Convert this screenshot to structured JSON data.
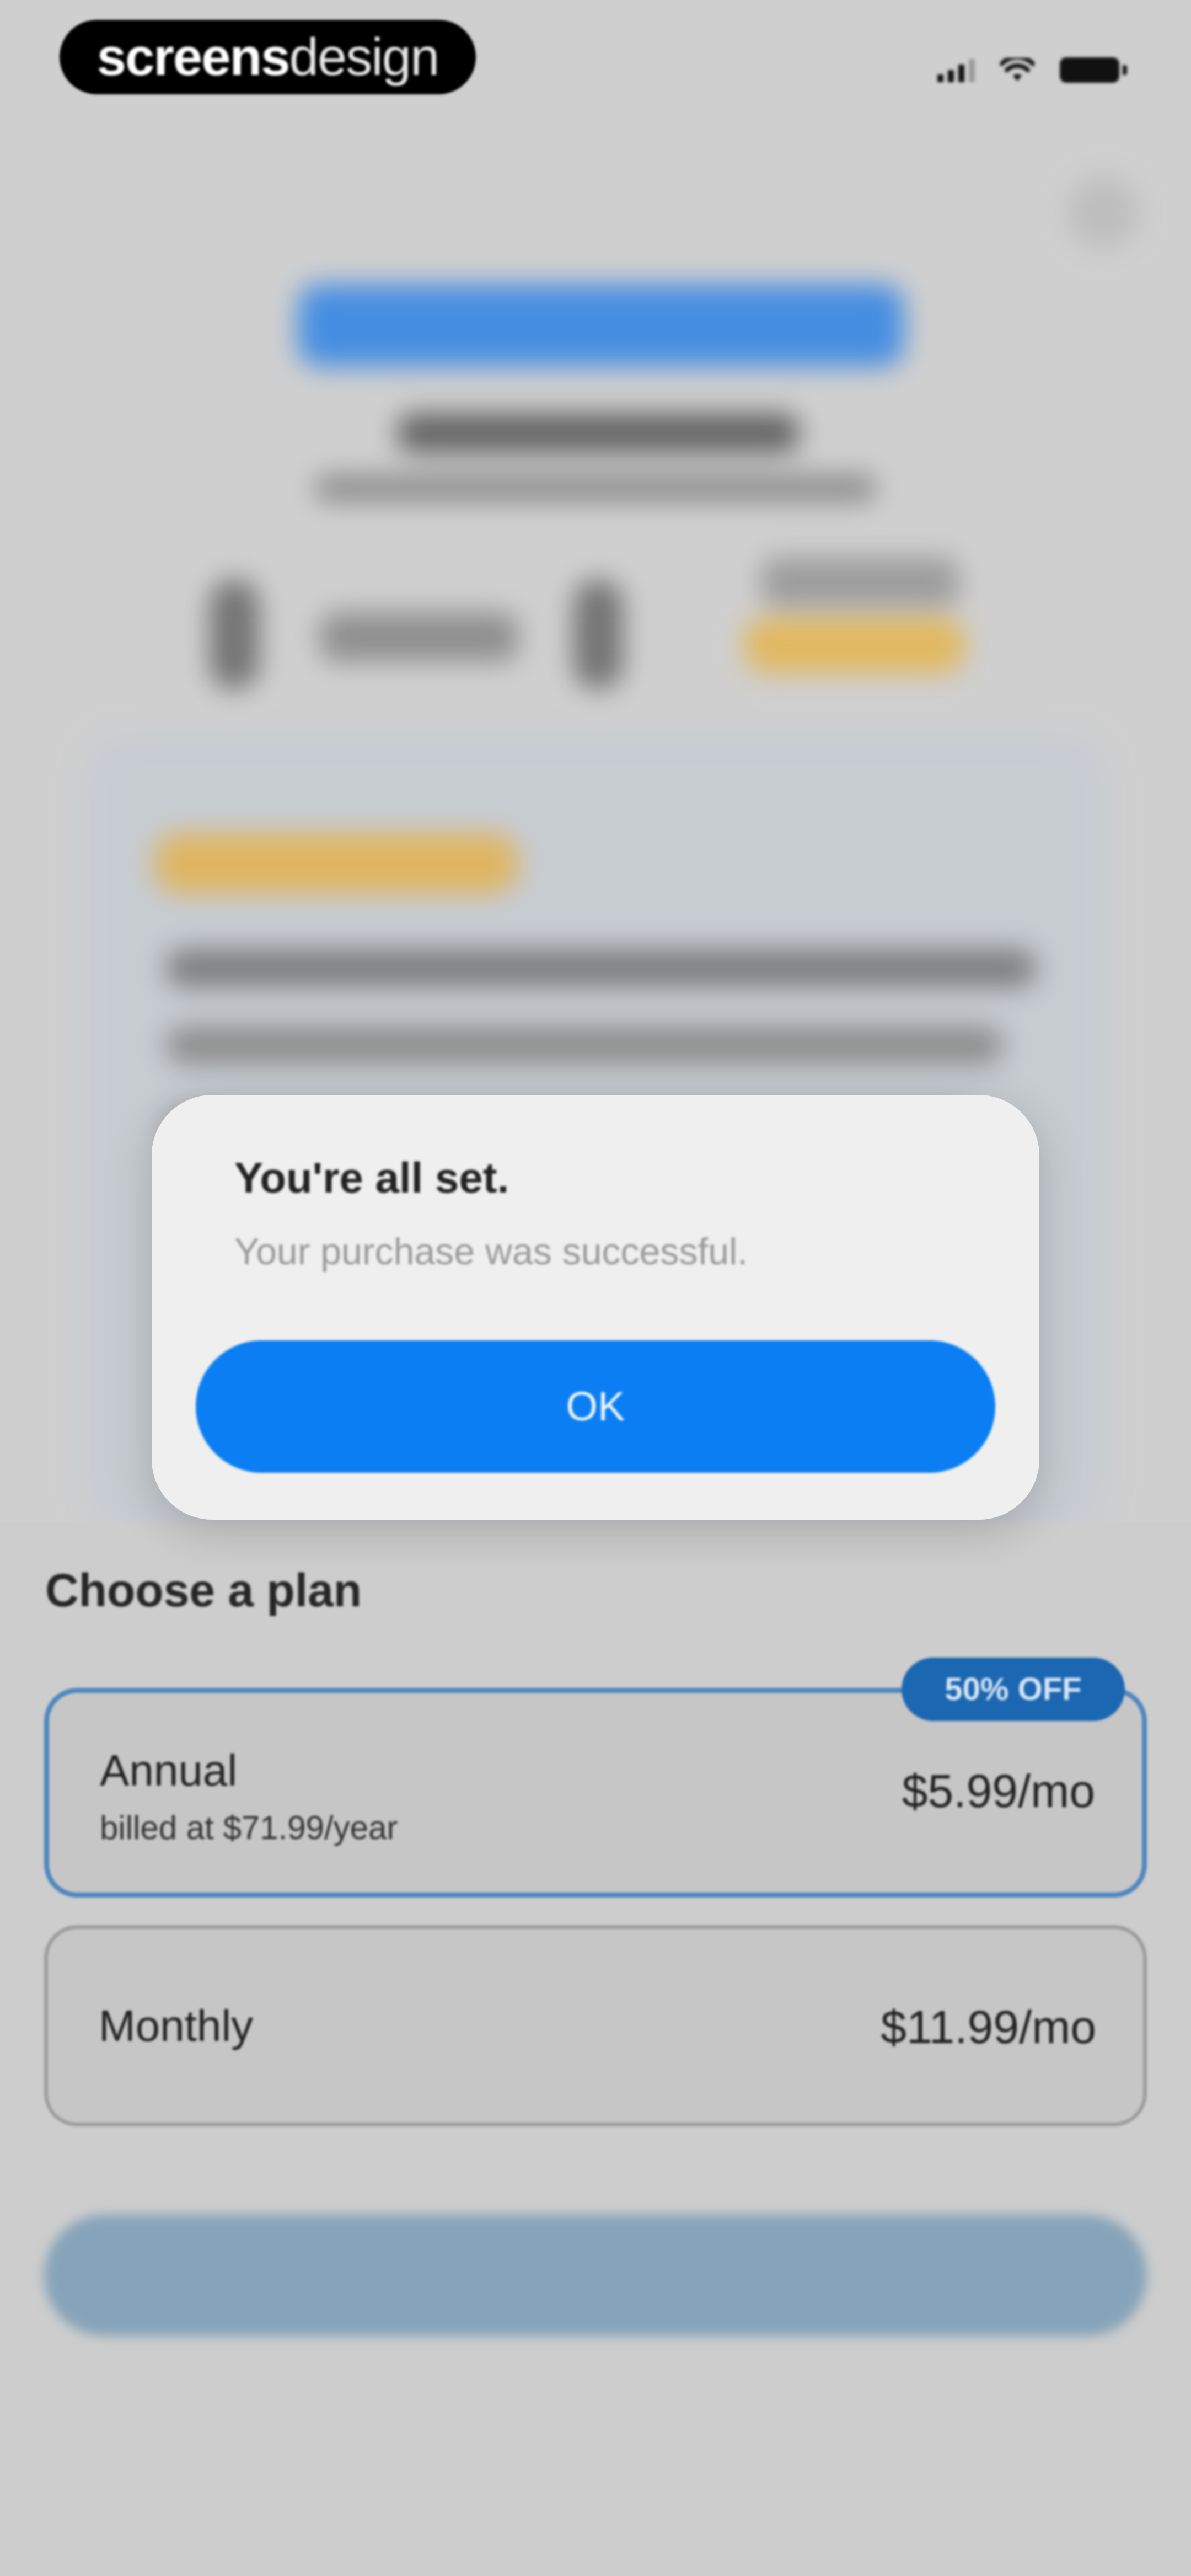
{
  "status_bar": {
    "brand_bold": "screens",
    "brand_light": "design",
    "icons": [
      "cellular-signal-icon",
      "wifi-icon",
      "battery-icon"
    ]
  },
  "alert": {
    "title": "You're all set.",
    "message": "Your purchase was successful.",
    "ok_label": "OK"
  },
  "plans": {
    "heading": "Choose a plan",
    "discount_badge": "50% OFF",
    "items": [
      {
        "name": "Annual",
        "billing": "billed at $71.99/year",
        "price": "$5.99/mo",
        "selected": true
      },
      {
        "name": "Monthly",
        "price": "$11.99/mo",
        "selected": false
      }
    ]
  },
  "colors": {
    "accent_blue": "#0a7ef2",
    "selected_border": "#4f86bf",
    "badge_blue": "#1c67b2",
    "background": "#cfcfcf"
  }
}
